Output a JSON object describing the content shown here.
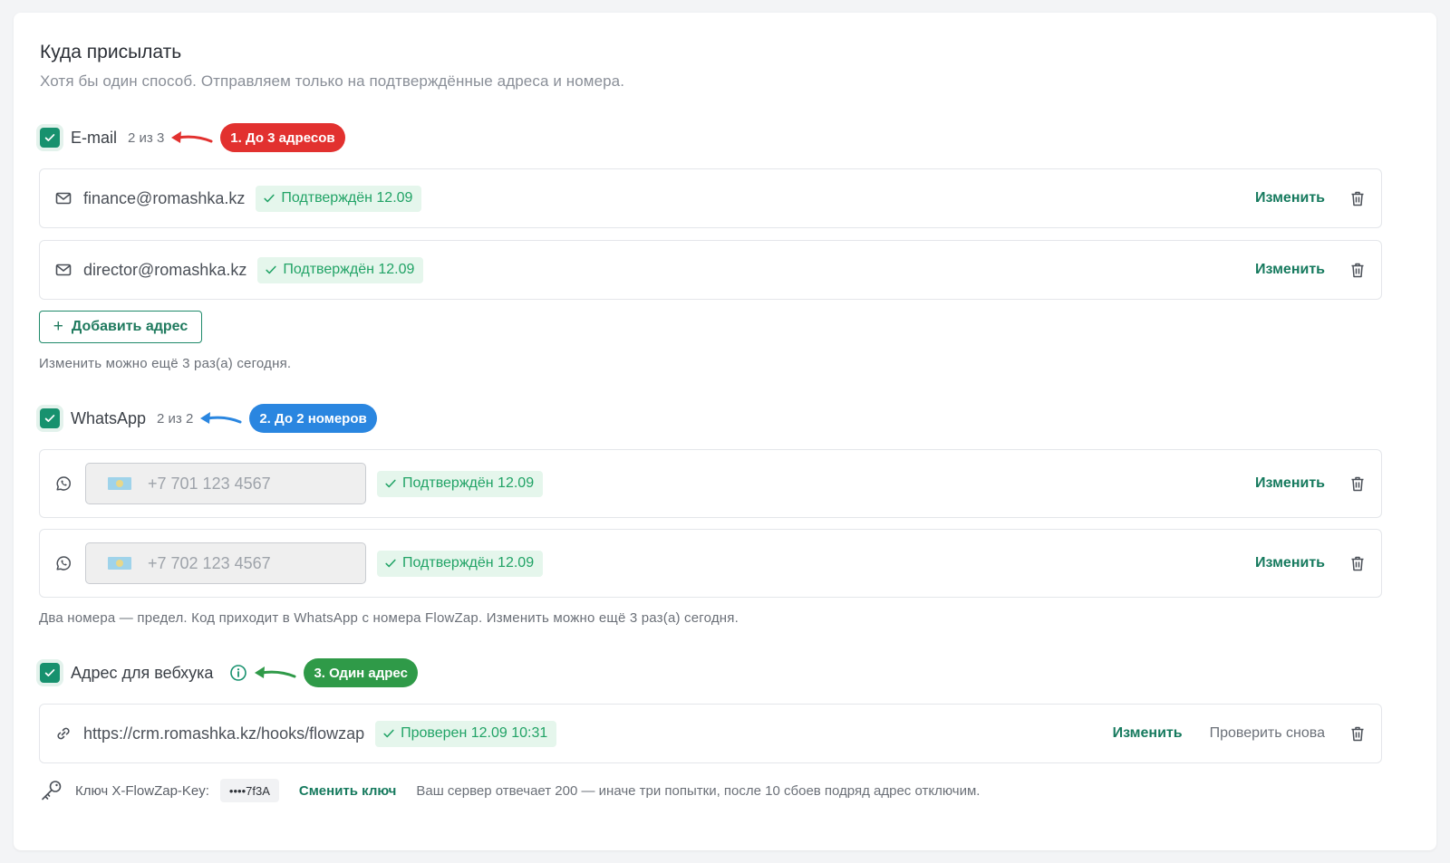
{
  "header": {
    "title": "Куда присылать",
    "subtitle": "Хотя бы один способ. Отправляем только на подтверждённые адреса и номера."
  },
  "email": {
    "label": "E-mail",
    "count": "2 из 3",
    "callout": "1. До 3 адресов",
    "callout_color": "#e2312f",
    "items": [
      {
        "address": "finance@romashka.kz",
        "status": "Подтверждён 12.09",
        "edit": "Изменить"
      },
      {
        "address": "director@romashka.kz",
        "status": "Подтверждён 12.09",
        "edit": "Изменить"
      }
    ],
    "add_button": "Добавить адрес",
    "note": "Изменить можно ещё 3 раз(а) сегодня."
  },
  "whatsapp": {
    "label": "WhatsApp",
    "count": "2 из 2",
    "callout": "2. До 2 номеров",
    "callout_color": "#2a86e0",
    "items": [
      {
        "phone": "+7 701 123 4567",
        "status": "Подтверждён 12.09",
        "edit": "Изменить"
      },
      {
        "phone": "+7 702 123 4567",
        "status": "Подтверждён 12.09",
        "edit": "Изменить"
      }
    ],
    "note": "Два номера — предел. Код приходит в WhatsApp с номера FlowZap. Изменить можно ещё 3 раз(а) сегодня."
  },
  "webhook": {
    "label": "Адрес для вебхука",
    "callout": "3. Один адрес",
    "callout_color": "#2f9a48",
    "url": "https://crm.romashka.kz/hooks/flowzap",
    "status": "Проверен 12.09 10:31",
    "edit": "Изменить",
    "recheck": "Проверить снова",
    "key_label": "Ключ X-FlowZap-Key:",
    "key_value": "••••7f3A",
    "change_key": "Сменить ключ",
    "key_note": "Ваш сервер отвечает 200 — иначе три попытки, после 10 сбоев подряд адрес отключим."
  },
  "colors": {
    "accent": "#17916e",
    "badge_bg": "#e5f6ec",
    "badge_text": "#21a366"
  }
}
